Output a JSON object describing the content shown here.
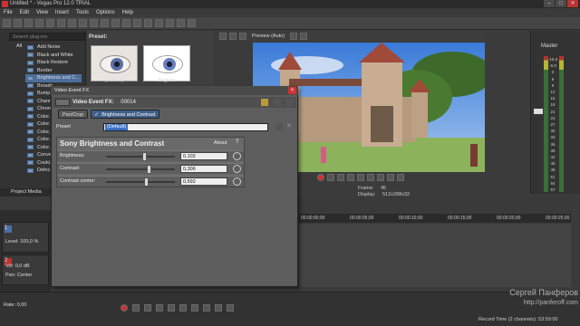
{
  "window": {
    "title": "Untitled * - Vegas Pro 12.0 TRIAL"
  },
  "menu": [
    "File",
    "Edit",
    "View",
    "Insert",
    "Tools",
    "Options",
    "Help"
  ],
  "explorer": {
    "search_placeholder": "Search plug-ins",
    "root_label": "All",
    "items": [
      "Add Noise",
      "Black and White",
      "Black Restore",
      "Border",
      "Brightness and C...",
      "Broadc...",
      "Bump...",
      "Chann...",
      "Chrom...",
      "Color...",
      "Color...",
      "Color...",
      "Color...",
      "Color...",
      "Conve...",
      "Cooki...",
      "Defoc..."
    ],
    "selected_index": 4
  },
  "presets": {
    "label": "Preset:",
    "thumbs": [
      "(Default)",
      "Brighter"
    ]
  },
  "preview": {
    "mode": "Preview (Auto)"
  },
  "frame_info": {
    "frame_label": "Frame:",
    "frame_value": "45",
    "display_label": "Display:",
    "display_value": "512x288x32"
  },
  "master": {
    "label": "Master",
    "scale": [
      "-16.5",
      "-6.0",
      "3",
      "6",
      "9",
      "12",
      "15",
      "18",
      "21",
      "24",
      "27",
      "30",
      "33",
      "36",
      "39",
      "42",
      "45",
      "48",
      "51",
      "54",
      "57"
    ]
  },
  "dialog": {
    "title": "Video Event FX",
    "fx_label": "Video Event FX:",
    "fx_id": "00014",
    "chain": [
      "Pan/Crop",
      "Brightness and Contrast"
    ],
    "preset_label": "Preset",
    "preset_value": "(Default)",
    "plugin_name": "Sony Brightness and Contrast",
    "about": "About",
    "help": "?",
    "params": [
      {
        "label": "Brightness:",
        "value": "0,102",
        "level": 0.55
      },
      {
        "label": "Contrast:",
        "value": "0,306",
        "level": 0.63
      },
      {
        "label": "Contrast center:",
        "value": "0,592",
        "level": 0.59
      }
    ]
  },
  "project_media_tab": "Project Media",
  "tracks": [
    {
      "num": "1",
      "label": "Level: 100,0 %",
      "type": "video"
    },
    {
      "num": "2",
      "label_vol": "Vol:",
      "vol_value": "0,0 dB",
      "label_pan": "Pan:",
      "pan_value": "Center",
      "type": "audio"
    }
  ],
  "ruler": [
    "00:00:00;00",
    "00:00:05;00",
    "00:00:10;00",
    "00:00:15;00",
    "00:00:20;00",
    "00:00:25;00"
  ],
  "status": {
    "rate": "Rate: 0,00",
    "record_time": "Record Time (2 channels): 53:59:00"
  },
  "watermark": {
    "line1": "Сергей Панферов",
    "line2": "http://panferoff.com"
  },
  "colors": {
    "selection": "#4d6e9a",
    "accent": "#3a6fc4",
    "record": "#cc3333"
  }
}
